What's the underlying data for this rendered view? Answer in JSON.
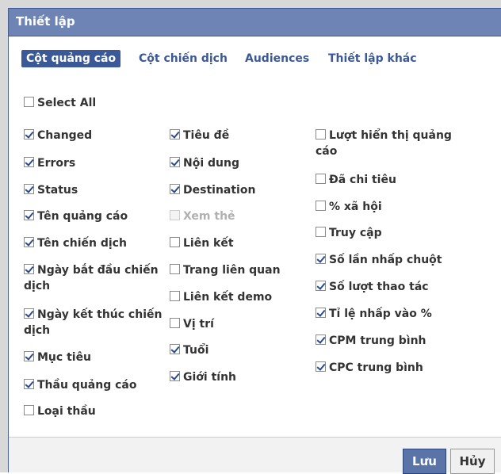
{
  "dialog": {
    "title": "Thiết lập"
  },
  "tabs": [
    {
      "label": "Cột quảng cáo",
      "active": true
    },
    {
      "label": "Cột chiến dịch",
      "active": false
    },
    {
      "label": "Audiences",
      "active": false
    },
    {
      "label": "Thiết lập khác",
      "active": false
    }
  ],
  "select_all": {
    "label": "Select All",
    "checked": false
  },
  "col1": [
    {
      "label": "Changed",
      "checked": true
    },
    {
      "label": "Errors",
      "checked": true
    },
    {
      "label": "Status",
      "checked": true
    },
    {
      "label": "Tên quảng cáo",
      "checked": true
    },
    {
      "label": "Tên chiến dịch",
      "checked": true
    },
    {
      "label": "Ngày bắt đầu chiến dịch",
      "checked": true
    },
    {
      "label": "Ngày kết thúc chiến dịch",
      "checked": true
    },
    {
      "label": "Mục tiêu",
      "checked": true
    },
    {
      "label": "Thầu quảng cáo",
      "checked": true
    },
    {
      "label": "Loại thầu",
      "checked": false
    }
  ],
  "col2": [
    {
      "label": "Tiêu đề",
      "checked": true
    },
    {
      "label": "Nội dung",
      "checked": true
    },
    {
      "label": "Destination",
      "checked": true
    },
    {
      "label": "Xem thẻ",
      "checked": false,
      "disabled": true
    },
    {
      "label": "Liên kết",
      "checked": false
    },
    {
      "label": "Trang liên quan",
      "checked": false
    },
    {
      "label": "Liên kết demo",
      "checked": false
    },
    {
      "label": "Vị trí",
      "checked": false
    },
    {
      "label": "Tuổi",
      "checked": true
    },
    {
      "label": "Giới tính",
      "checked": true
    }
  ],
  "col3": [
    {
      "label": "Lượt hiển thị quảng cáo",
      "checked": false
    },
    {
      "label": "Đã chi tiêu",
      "checked": false
    },
    {
      "label": "% xã hội",
      "checked": false
    },
    {
      "label": "Truy cập",
      "checked": false
    },
    {
      "label": "Số lần nhấp chuột",
      "checked": true
    },
    {
      "label": "Số lượt thao tác",
      "checked": true
    },
    {
      "label": "Tỉ lệ nhấp vào %",
      "checked": true
    },
    {
      "label": "CPM trung bình",
      "checked": true
    },
    {
      "label": "CPC trung bình",
      "checked": true
    }
  ],
  "footer": {
    "save_label": "Lưu",
    "cancel_label": "Hủy"
  },
  "colors": {
    "header_bg": "#6d84b4",
    "accent": "#3b5998",
    "save_bg": "#5b74a8"
  }
}
